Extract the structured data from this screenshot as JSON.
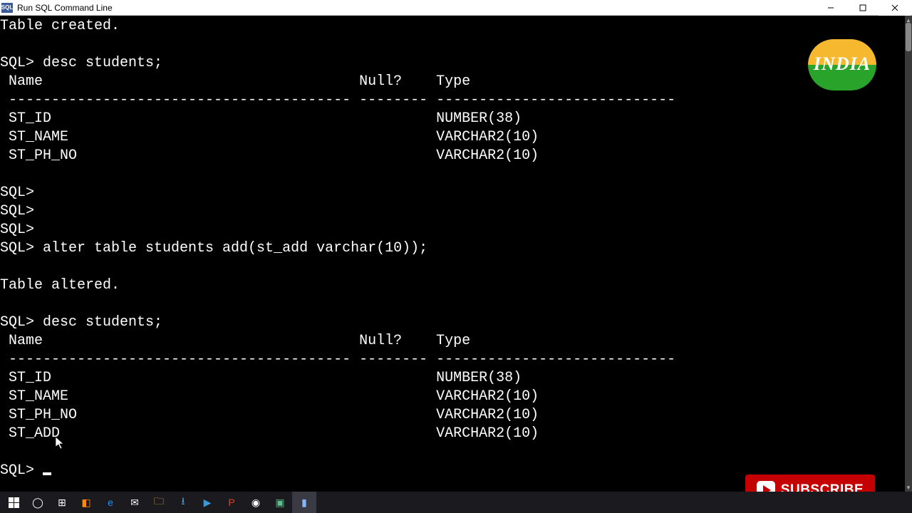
{
  "window": {
    "title": "Run SQL Command Line",
    "app_short": "SQL"
  },
  "terminal": {
    "created_msg": "Table created.",
    "prompt": "SQL>",
    "desc_cmd": "desc students;",
    "hdr_name": " Name",
    "hdr_null": "Null?",
    "hdr_type": "Type",
    "sep_name": " ----------------------------------------",
    "sep_null": "--------",
    "sep_type": "----------------------------",
    "rows1": [
      {
        "name": " ST_ID",
        "null_": "",
        "type": "NUMBER(38)"
      },
      {
        "name": " ST_NAME",
        "null_": "",
        "type": "VARCHAR2(10)"
      },
      {
        "name": " ST_PH_NO",
        "null_": "",
        "type": "VARCHAR2(10)"
      }
    ],
    "alter_cmd": "alter table students add(st_add varchar(10));",
    "altered_msg": "Table altered.",
    "rows2": [
      {
        "name": " ST_ID",
        "null_": "",
        "type": "NUMBER(38)"
      },
      {
        "name": " ST_NAME",
        "null_": "",
        "type": "VARCHAR2(10)"
      },
      {
        "name": " ST_PH_NO",
        "null_": "",
        "type": "VARCHAR2(10)"
      },
      {
        "name": " ST_ADD",
        "null_": "",
        "type": "VARCHAR2(10)"
      }
    ]
  },
  "logo_text": "INDIA",
  "subscribe_label": "SUBSCRIBE",
  "col_widths": {
    "name": 42,
    "null_": 9
  }
}
